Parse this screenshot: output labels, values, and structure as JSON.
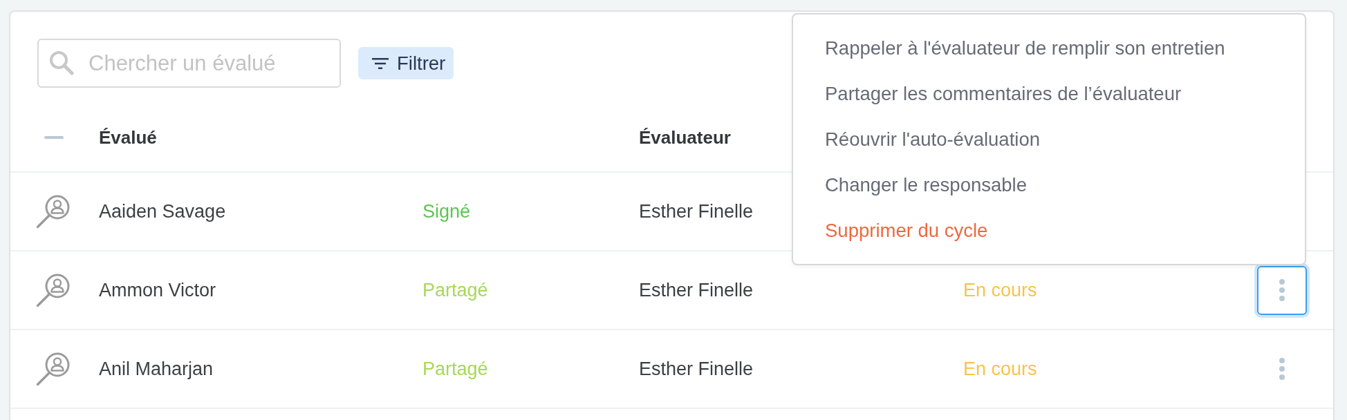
{
  "search": {
    "placeholder": "Chercher un évalué"
  },
  "filter_button": {
    "label": "Filtrer"
  },
  "table": {
    "columns": {
      "evaluee": "Évalué",
      "evaluator": "Évaluateur"
    },
    "rows": [
      {
        "name": "Aaiden Savage",
        "status": {
          "text": "Signé",
          "color": "#5cc653"
        },
        "evaluator": "Esther Finelle"
      },
      {
        "name": "Ammon Victor",
        "status": {
          "text": "Partagé",
          "color": "#a6d955"
        },
        "evaluator": "Esther Finelle",
        "progress": {
          "text": "En cours",
          "color": "#f7c34a"
        },
        "actions": {
          "selected": true
        }
      },
      {
        "name": "Anil Maharjan",
        "status": {
          "text": "Partagé",
          "color": "#a6d955"
        },
        "evaluator": "Esther Finelle",
        "progress": {
          "text": "En cours",
          "color": "#f7c34a"
        },
        "actions": {
          "selected": false
        }
      }
    ]
  },
  "context_menu": {
    "items": [
      {
        "label": "Rappeler à l'évaluateur de remplir son entretien",
        "kind": "normal"
      },
      {
        "label": "Partager les commentaires de l’évaluateur",
        "kind": "normal"
      },
      {
        "label": "Réouvrir l'auto-évaluation",
        "kind": "normal"
      },
      {
        "label": "Changer le responsable",
        "kind": "normal"
      },
      {
        "label": "Supprimer du cycle",
        "kind": "danger"
      }
    ]
  }
}
